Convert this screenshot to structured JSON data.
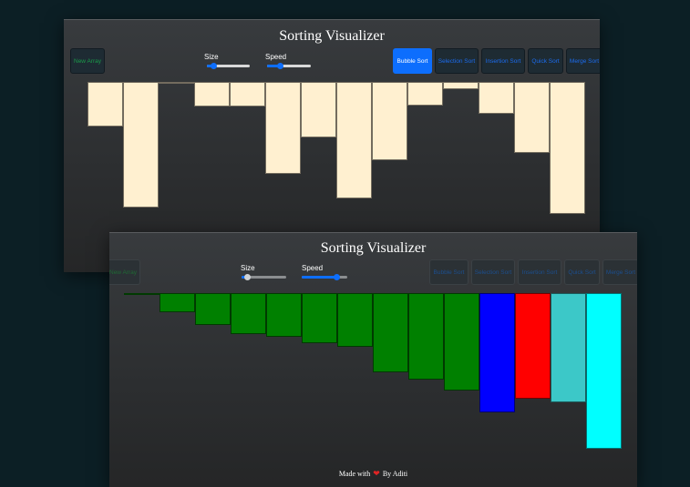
{
  "window1": {
    "title": "Sorting Visualizer",
    "buttons": {
      "new_array": "New Array",
      "bubble": "Bubble Sort",
      "selection": "Selection Sort",
      "insertion": "Insertion Sort",
      "quick": "Quick Sort",
      "merge": "Merge Sort"
    },
    "active_algorithm": "Bubble Sort",
    "size_label": "Size",
    "speed_label": "Speed",
    "size_level": 0.15,
    "speed_level": 0.3,
    "bar_color": "#fff0d0",
    "bar_values": [
      49,
      138,
      1,
      27,
      27,
      101,
      61,
      128,
      86,
      26,
      8,
      35,
      78,
      145
    ]
  },
  "window2": {
    "title": "Sorting Visualizer",
    "buttons": {
      "new_array": "New Array",
      "bubble": "Bubble Sort",
      "selection": "Selection Sort",
      "insertion": "Insertion Sort",
      "quick": "Quick Sort",
      "merge": "Merge Sort"
    },
    "size_label": "Size",
    "speed_label": "Speed",
    "size_level": 0.12,
    "speed_level": 0.75,
    "bars": [
      {
        "value": 2,
        "color": "#008000"
      },
      {
        "value": 21,
        "color": "#008000"
      },
      {
        "value": 35,
        "color": "#008000"
      },
      {
        "value": 45,
        "color": "#008000"
      },
      {
        "value": 48,
        "color": "#008000"
      },
      {
        "value": 55,
        "color": "#008000"
      },
      {
        "value": 59,
        "color": "#008000"
      },
      {
        "value": 87,
        "color": "#008000"
      },
      {
        "value": 95,
        "color": "#008000"
      },
      {
        "value": 107,
        "color": "#008000"
      },
      {
        "value": 131,
        "color": "#0000ff"
      },
      {
        "value": 116,
        "color": "#ff0000"
      },
      {
        "value": 120,
        "color": "#3cc8c8"
      },
      {
        "value": 171,
        "color": "#00ffff"
      }
    ],
    "footer": {
      "prefix": "Made with",
      "suffix": "By Aditi"
    }
  }
}
